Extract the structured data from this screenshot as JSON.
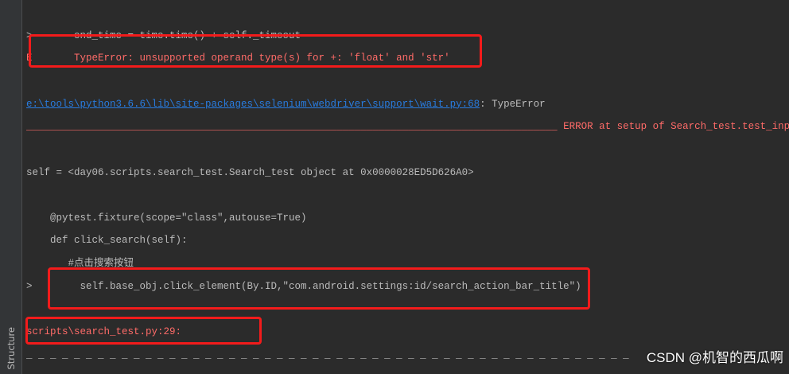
{
  "colors": {
    "background": "#2b2b2b",
    "tool_strip": "#333537",
    "text_default": "#bbbbbb",
    "text_error": "#ff6b68",
    "link": "#287bde",
    "annotation_box": "#f31b1b",
    "watermark": "#ffffff"
  },
  "tool_strip": {
    "structure_tab": "Structure"
  },
  "console": {
    "traceback_line": ">       end_time = time.time() + self._timeout",
    "error_line": "E       TypeError: unsupported operand type(s) for +: 'float' and 'str'",
    "location_link": "e:\\tools\\python3.6.6\\lib\\site-packages\\selenium\\webdriver\\support\\wait.py:68",
    "location_suffix": ": TypeError",
    "error_header": "_________________________________________________________________________________________ ERROR at setup of Search_test.test_inp",
    "self_repr": "self = <day06.scripts.search_test.Search_test object at 0x0000028ED5D626A0>",
    "source": [
      "    @pytest.fixture(scope=\"class\",autouse=True)",
      "    def click_search(self):",
      "       #点击搜索按钮",
      ">        self.base_obj.click_element(By.ID,\"com.android.settings:id/search_action_bar_title\")"
    ],
    "file_location": "scripts\\search_test.py:29:",
    "separator": "_ _ _ _ _ _ _ _ _ _ _ _ _ _ _ _ _ _ _ _ _ _ _ _ _ _ _ _ _ _ _ _ _ _ _ _ _ _ _ _ _ _ _ _ _ _ _ _ _ _ _"
  },
  "watermark": "CSDN @机智的西瓜啊"
}
